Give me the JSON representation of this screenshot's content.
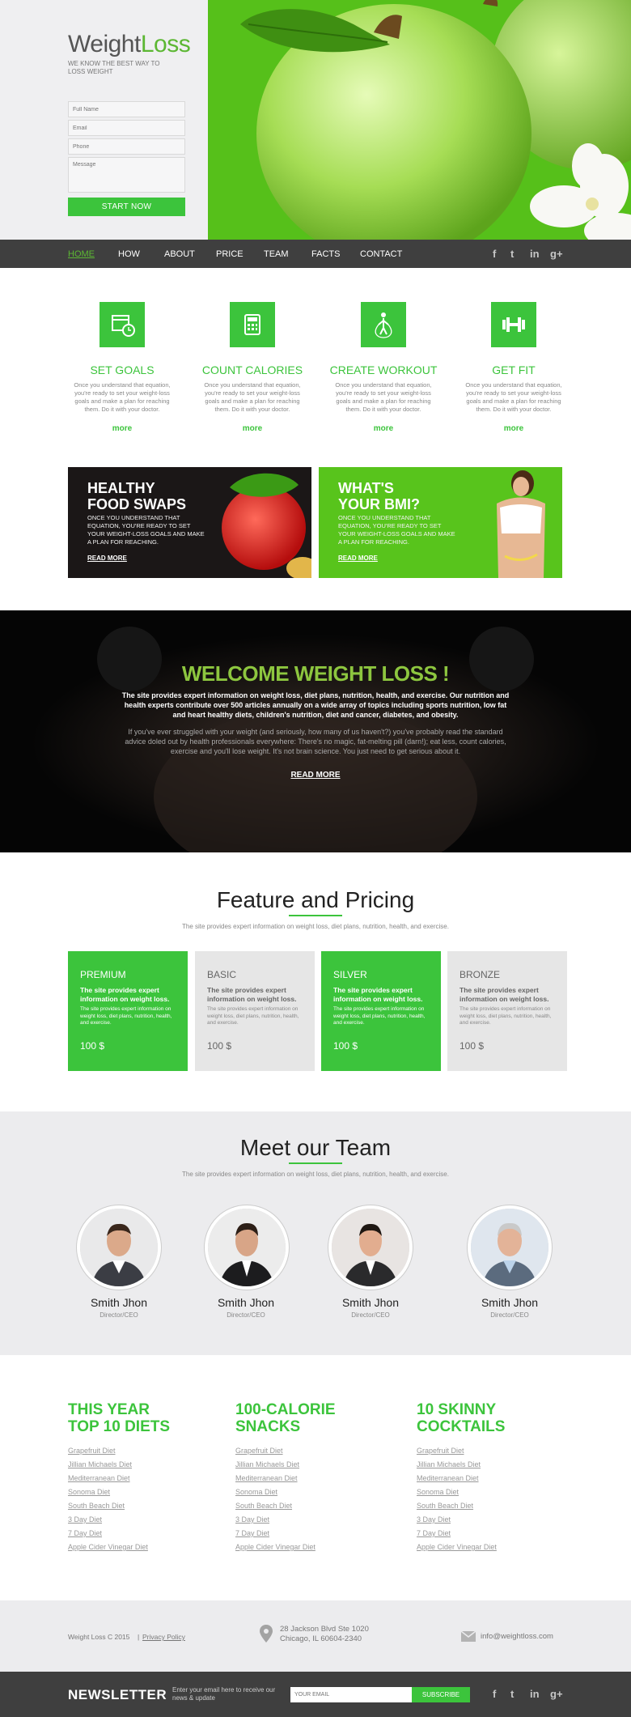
{
  "hero": {
    "logo_part1": "Weight",
    "logo_part2": "Loss",
    "tagline": "WE KNOW THE BEST WAY TO LOSS WEIGHT",
    "form": {
      "full_name_placeholder": "Full Name",
      "email_placeholder": "Email",
      "phone_placeholder": "Phone",
      "message_placeholder": "Message",
      "submit_label": "START NOW"
    }
  },
  "nav": {
    "items": [
      "HOME",
      "HOW",
      "ABOUT",
      "PRICE",
      "TEAM",
      "FACTS",
      "CONTACT"
    ],
    "active": "HOME",
    "social": [
      "f",
      "t",
      "in",
      "g+"
    ]
  },
  "features": [
    {
      "icon": "calendar-clock-icon",
      "title": "SET GOALS",
      "text": "Once you understand that equation, you're ready to set your weight-loss goals and make a plan for reaching them. Do it with your doctor.",
      "more": "more"
    },
    {
      "icon": "calculator-icon",
      "title": "COUNT CALORIES",
      "text": "Once you understand that equation, you're ready to set your weight-loss goals and make a plan for reaching them. Do it with your doctor.",
      "more": "more"
    },
    {
      "icon": "jump-rope-icon",
      "title": "CREATE WORKOUT",
      "text": "Once you understand that equation, you're ready to set your weight-loss goals and make a plan for reaching them. Do it with your doctor.",
      "more": "more"
    },
    {
      "icon": "dumbbell-icon",
      "title": "GET FIT",
      "text": "Once you understand that equation, you're ready to set your weight-loss goals and make a plan for reaching them. Do it with your doctor.",
      "more": "more"
    }
  ],
  "promos": [
    {
      "title_line1": "HEALTHY",
      "title_line2": "FOOD SWAPS",
      "text": "ONCE YOU UNDERSTAND THAT EQUATION, YOU'RE READY TO SET YOUR WEIGHT-LOSS GOALS AND MAKE A PLAN FOR REACHING.",
      "link": "READ MORE"
    },
    {
      "title_line1": "WHAT'S",
      "title_line2": "YOUR BMI?",
      "text": "ONCE YOU UNDERSTAND THAT EQUATION, YOU'RE READY TO SET YOUR WEIGHT-LOSS GOALS AND MAKE A PLAN FOR REACHING.",
      "link": "READ MORE"
    }
  ],
  "welcome": {
    "title": "WELCOME WEIGHT LOSS !",
    "bold_text": "The site provides expert information on weight loss, diet plans, nutrition, health, and exercise. Our nutrition and health experts contribute over 500 articles annually on a wide array of topics including sports nutrition, low fat and heart healthy diets, children's nutrition, diet and cancer, diabetes, and obesity.",
    "body_text": "If you've ever struggled with your weight (and seriously, how many of us haven't?) you've probably read the standard advice doled out by health professionals everywhere: There's no magic, fat-melting pill (darn!); eat less, count calories, exercise and you'll lose weight. It's not brain science. You just need to get serious about it.",
    "link": "READ MORE"
  },
  "pricing": {
    "title": "Feature and Pricing",
    "subtitle": "The site provides expert information on weight loss, diet plans, nutrition, health, and exercise.",
    "plans": [
      {
        "name": "PREMIUM",
        "bold": "The site provides expert information on weight loss.",
        "small": "The site provides expert information on weight loss, diet plans, nutrition, health, and exercise.",
        "price": "100 $",
        "style": "green"
      },
      {
        "name": "BASIC",
        "bold": "The site provides expert information on weight loss.",
        "small": "The site provides expert information on weight loss, diet plans, nutrition, health, and exercise.",
        "price": "100 $",
        "style": "grey"
      },
      {
        "name": "SILVER",
        "bold": "The site provides expert information on weight loss.",
        "small": "The site provides expert information on weight loss, diet plans, nutrition, health, and exercise.",
        "price": "100 $",
        "style": "green"
      },
      {
        "name": "BRONZE",
        "bold": "The site provides expert information on weight loss.",
        "small": "The site provides expert information on weight loss, diet plans, nutrition, health, and exercise.",
        "price": "100 $",
        "style": "grey"
      }
    ]
  },
  "team": {
    "title": "Meet our Team",
    "subtitle": "The site provides expert information on weight loss, diet plans, nutrition, health, and exercise.",
    "members": [
      {
        "name": "Smith Jhon",
        "role": "Director/CEO"
      },
      {
        "name": "Smith Jhon",
        "role": "Director/CEO"
      },
      {
        "name": "Smith Jhon",
        "role": "Director/CEO"
      },
      {
        "name": "Smith Jhon",
        "role": "Director/CEO"
      }
    ]
  },
  "lists": [
    {
      "title_line1": "THIS YEAR",
      "title_line2": "TOP 10 DIETS",
      "items": [
        "Grapefruit Diet",
        "Jillian Michaels Diet",
        "Mediterranean Diet",
        "Sonoma Diet",
        "South Beach Diet",
        "3 Day Diet",
        "7 Day Diet",
        "Apple Cider Vinegar Diet"
      ]
    },
    {
      "title_line1": "100-CALORIE",
      "title_line2": "SNACKS",
      "items": [
        "Grapefruit Diet",
        "Jillian Michaels Diet",
        "Mediterranean Diet",
        "Sonoma Diet",
        "South Beach Diet",
        "3 Day Diet",
        "7 Day Diet",
        "Apple Cider Vinegar Diet"
      ]
    },
    {
      "title_line1": "10 SKINNY",
      "title_line2": "COCKTAILS",
      "items": [
        "Grapefruit Diet",
        "Jillian Michaels Diet",
        "Mediterranean Diet",
        "Sonoma Diet",
        "South Beach Diet",
        "3 Day Diet",
        "7 Day Diet",
        "Apple Cider Vinegar Diet"
      ]
    }
  ],
  "footer": {
    "copyright": "Weight Loss C 2015",
    "separator": "|",
    "privacy": "Privacy Policy",
    "address_line1": "28 Jackson Blvd Ste 1020",
    "address_line2": "Chicago, IL 60604-2340",
    "email": "info@weightloss.com"
  },
  "newsletter": {
    "title": "NEWSLETTER",
    "subtitle": "Enter your email here to receive our news & update",
    "placeholder": "YOUR EMAIL",
    "button": "SUBSCRIBE"
  },
  "colors": {
    "accent": "#3cc43c",
    "dark": "#3f3f3f",
    "light": "#ececee"
  }
}
